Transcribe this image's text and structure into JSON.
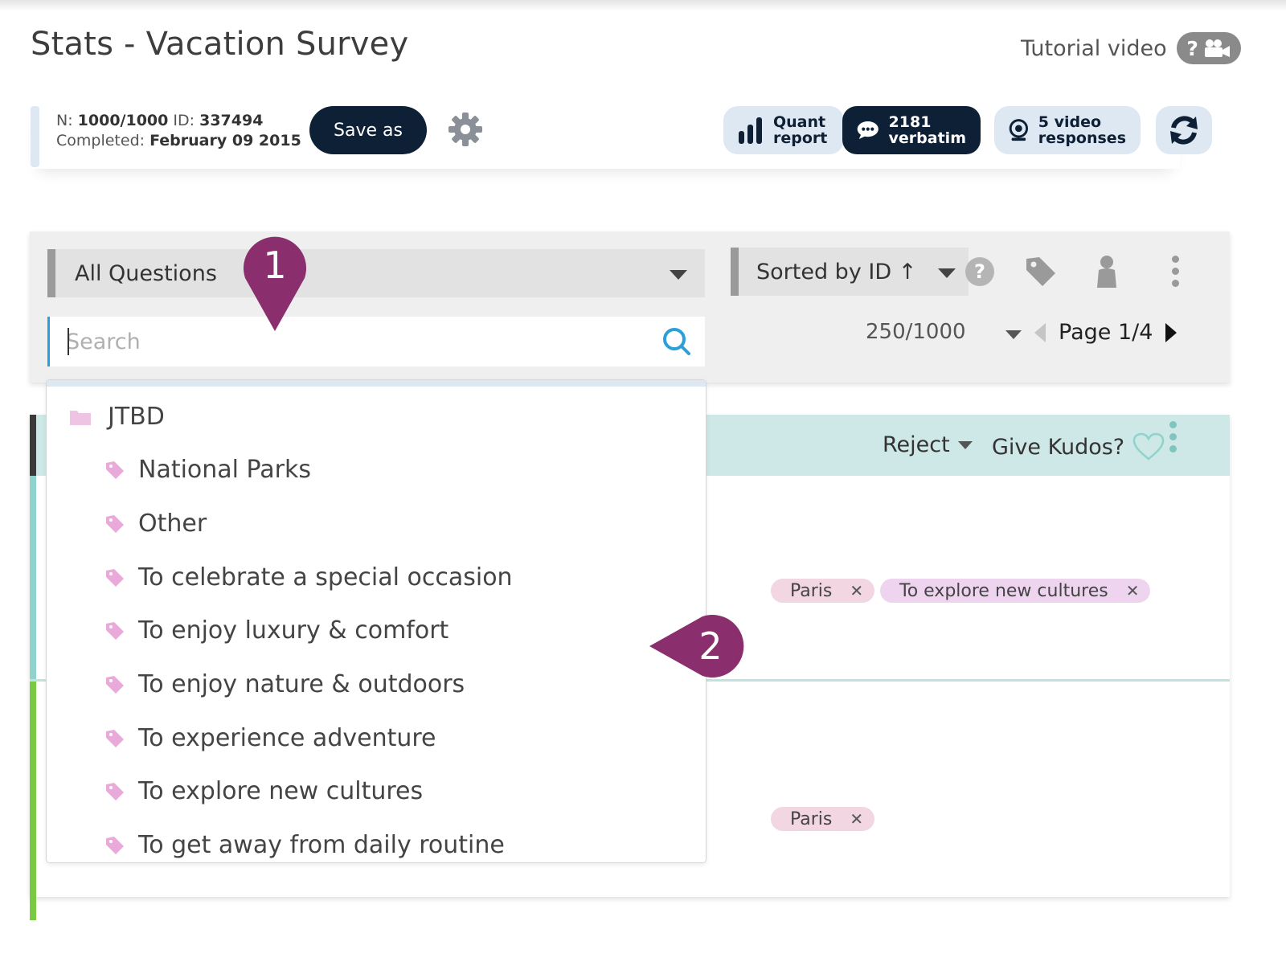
{
  "header": {
    "title": "Stats - Vacation Survey",
    "tutorial_label": "Tutorial video",
    "tutorial_icon": "?"
  },
  "info": {
    "n_label": "N:",
    "n_value": "1000/1000",
    "id_label": "ID:",
    "id_value": "337494",
    "completed_label": "Completed:",
    "completed_value": "February 09 2015"
  },
  "actions": {
    "save_as": "Save as",
    "quant_report": "Quant\nreport",
    "verbatim": "2181\nverbatim",
    "video_responses": "5 video\nresponses"
  },
  "filters": {
    "question_select": "All Questions",
    "search_placeholder": "Search",
    "sort_select": "Sorted by ID ↑",
    "per_page": "250/1000",
    "page": "Page 1/4"
  },
  "results": {
    "reject": "Reject",
    "kudos": "Give Kudos?",
    "row1_tags": [
      "Paris",
      "To explore new cultures"
    ],
    "row2_tags": [
      "Paris"
    ]
  },
  "dropdown": {
    "folder": "JTBD",
    "items": [
      "National Parks",
      "Other",
      "To celebrate a special occasion",
      "To enjoy luxury & comfort",
      "To enjoy nature & outdoors",
      "To experience adventure",
      "To explore new cultures",
      "To get away from daily routine"
    ]
  },
  "markers": {
    "m1": "1",
    "m2": "2"
  },
  "colors": {
    "navy": "#0e2035",
    "light_blue": "#dde8f3",
    "teal_head": "#cde8e6",
    "marker": "#8a2e6e",
    "tag_pink": "#f2d6e2",
    "tag_lilac": "#efd4ef"
  }
}
